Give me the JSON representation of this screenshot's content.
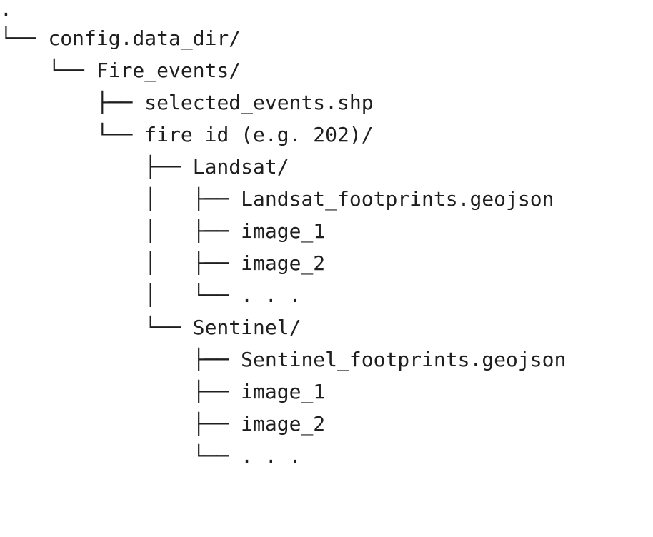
{
  "tree": {
    "lines": [
      {
        "prefix": "",
        "label": "."
      },
      {
        "prefix": "└── ",
        "label": "config.data_dir/"
      },
      {
        "prefix": "    └── ",
        "label": "Fire_events/"
      },
      {
        "prefix": "        ├── ",
        "label": "selected_events.shp"
      },
      {
        "prefix": "        └── ",
        "label": "fire id (e.g. 202)/"
      },
      {
        "prefix": "            ├── ",
        "label": "Landsat/"
      },
      {
        "prefix": "            │   ├── ",
        "label": "Landsat_footprints.geojson"
      },
      {
        "prefix": "            │   ├── ",
        "label": "image_1"
      },
      {
        "prefix": "            │   ├── ",
        "label": "image_2"
      },
      {
        "prefix": "            │   └── ",
        "label": ". . ."
      },
      {
        "prefix": "            └── ",
        "label": "Sentinel/"
      },
      {
        "prefix": "                ├── ",
        "label": "Sentinel_footprints.geojson"
      },
      {
        "prefix": "                ├── ",
        "label": "image_1"
      },
      {
        "prefix": "                ├── ",
        "label": "image_2"
      },
      {
        "prefix": "                └── ",
        "label": ". . ."
      }
    ]
  }
}
